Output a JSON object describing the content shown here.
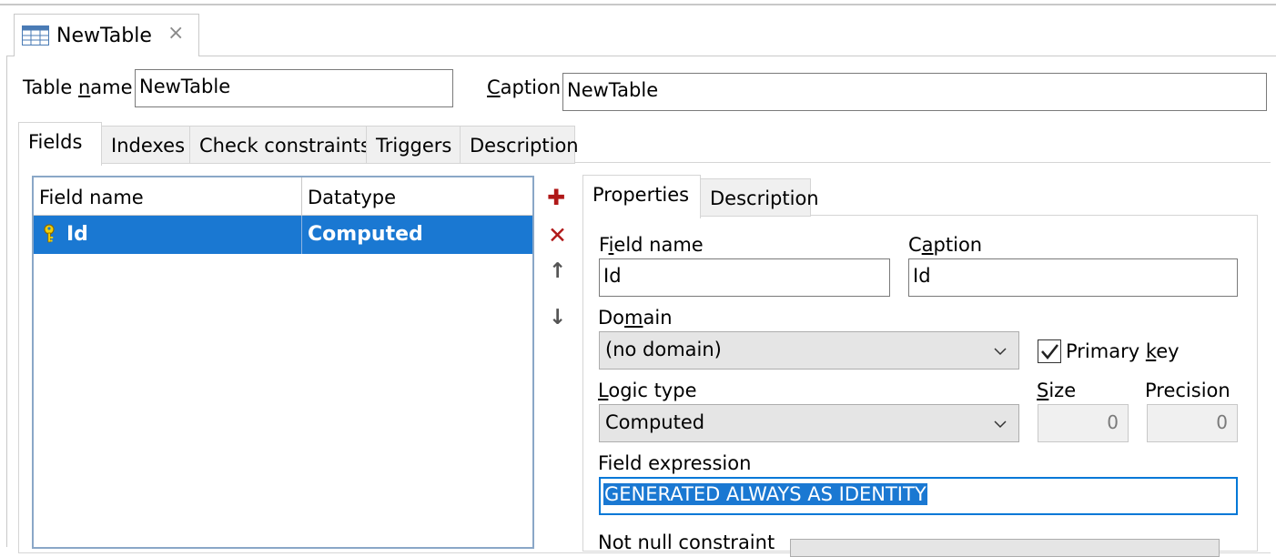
{
  "document_tab": {
    "title": "NewTable",
    "close_glyph": "×"
  },
  "table": {
    "name_label_pre": "Table ",
    "name_label_u": "n",
    "name_label_post": "ame",
    "name_value": "NewTable",
    "caption_label_u": "C",
    "caption_label_post": "aption",
    "caption_value": "NewTable"
  },
  "tabs": [
    "Fields",
    "Indexes",
    "Check constraints",
    "Triggers",
    "Description"
  ],
  "grid": {
    "columns": [
      "Field name",
      "Datatype"
    ],
    "rows": [
      {
        "name": "Id",
        "datatype": "Computed",
        "primary_key": true
      }
    ]
  },
  "actions": {
    "add": "✚",
    "delete": "✕",
    "up": "↑",
    "down": "↓"
  },
  "props_tabs": [
    "Properties",
    "Description"
  ],
  "props": {
    "field_name_label_pre": "F",
    "field_name_label_u": "i",
    "field_name_label_post": "eld name",
    "field_name_value": "Id",
    "caption_label_pre": "C",
    "caption_label_u": "a",
    "caption_label_post": "ption",
    "caption_value": "Id",
    "domain_label_pre": "Do",
    "domain_label_u": "m",
    "domain_label_post": "ain",
    "domain_value": "(no domain)",
    "primary_key_label_pre": "Primary ",
    "primary_key_label_u": "k",
    "primary_key_label_post": "ey",
    "primary_key_checked": true,
    "logic_type_label_u": "L",
    "logic_type_label_post": "ogic type",
    "logic_type_value": "Computed",
    "size_label_u": "S",
    "size_label_post": "ize",
    "size_value": "0",
    "precision_label": "Precision",
    "precision_value": "0",
    "field_expression_label": "Field expression",
    "field_expression_value": "GENERATED ALWAYS AS IDENTITY",
    "not_null_label": "Not null constraint"
  },
  "colors": {
    "selection": "#1a78d2",
    "accent_red": "#b01818"
  }
}
